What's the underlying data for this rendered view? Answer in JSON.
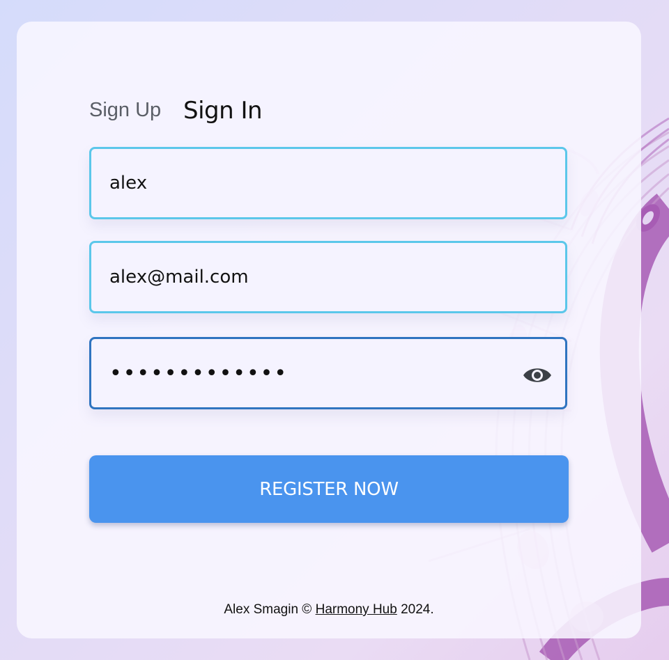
{
  "tabs": {
    "signup_label": "Sign Up",
    "signin_label": "Sign In"
  },
  "form": {
    "username_value": "alex",
    "email_value": "alex@mail.com",
    "password_value": "•••••••••••••",
    "register_label": "REGISTER NOW"
  },
  "footer": {
    "author": "Alex Smagin ©",
    "link_text": "Harmony Hub",
    "year": "2024."
  },
  "colors": {
    "field_border": "#5bc7ea",
    "field_border_focused": "#2f74c0",
    "button": "#4a94ee",
    "background_art": "#a75cb4"
  },
  "icons": {
    "password_toggle": "eye-icon",
    "background": "music-staff-notes-art"
  }
}
